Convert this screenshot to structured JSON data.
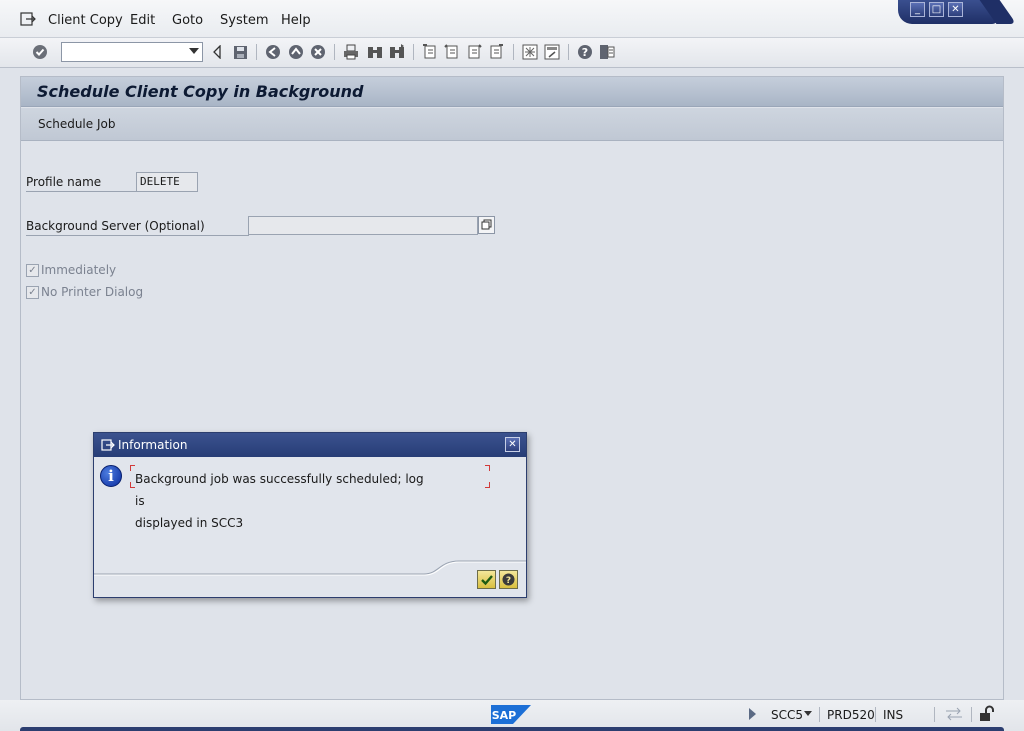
{
  "menu": {
    "items": [
      {
        "label": "Client Copy"
      },
      {
        "label": "Edit"
      },
      {
        "label": "Goto"
      },
      {
        "label": "System"
      },
      {
        "label": "Help"
      }
    ]
  },
  "window_controls": {
    "minimize": "_",
    "maximize": "□",
    "close": "✕"
  },
  "toolbar": {
    "command_field_value": "",
    "icons": [
      "enter-icon",
      "back-icon",
      "save-icon",
      "back-nav-icon",
      "exit-icon",
      "cancel-icon",
      "print-icon",
      "find-icon",
      "find-next-icon",
      "first-page-icon",
      "previous-page-icon",
      "next-page-icon",
      "last-page-icon",
      "create-session-icon",
      "shortcut-icon",
      "help-icon",
      "customize-layout-icon"
    ]
  },
  "page": {
    "title": "Schedule Client Copy in Background",
    "app_button": "Schedule Job"
  },
  "form": {
    "profile_name_label": "Profile name",
    "profile_name_value": "DELETE",
    "server_label": "Background Server (Optional)",
    "server_value": "",
    "immediately_label": "Immediately",
    "immediately_checked": true,
    "no_printer_label": "No Printer Dialog",
    "no_printer_checked": true
  },
  "dialog": {
    "title": "Information",
    "message_line1": "Background job was successfully scheduled; log is",
    "message_line2": "displayed in SCC3",
    "ok_icon": "checkmark-icon",
    "help_icon": "help-icon"
  },
  "status": {
    "logo_text": "SAP",
    "transaction": "SCC5",
    "server": "PRD520",
    "mode": "INS"
  }
}
